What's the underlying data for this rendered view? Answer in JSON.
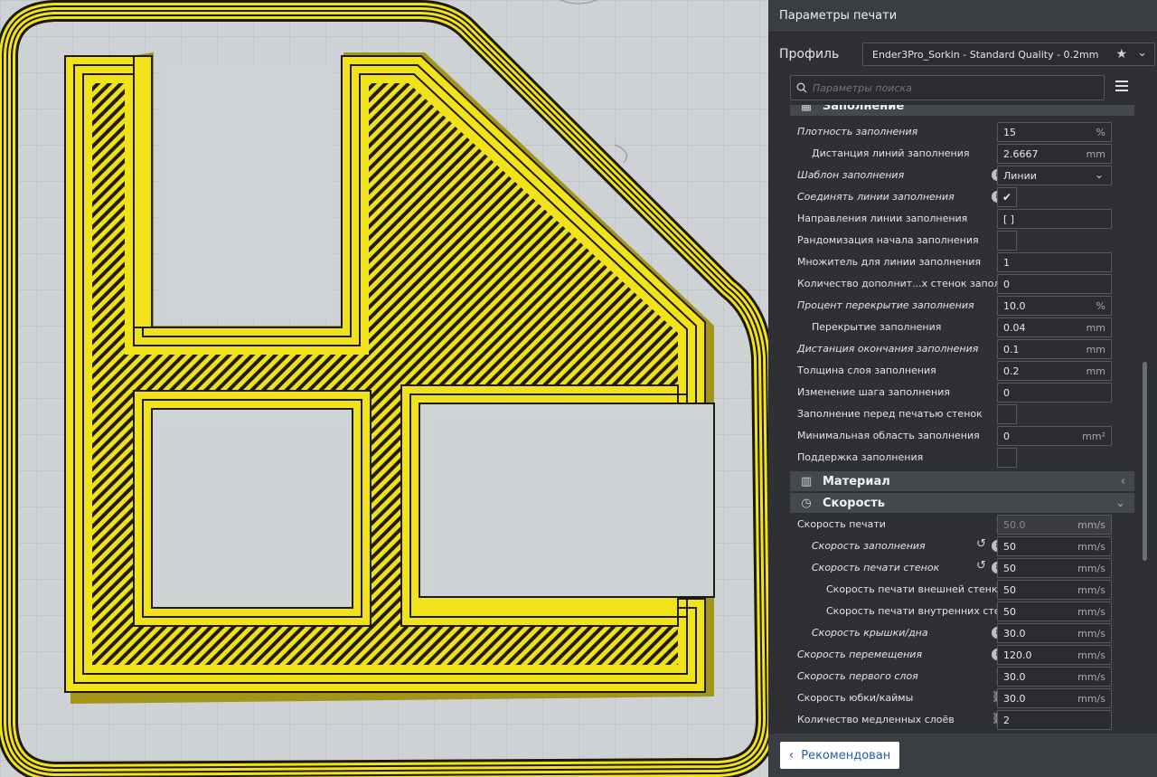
{
  "panel": {
    "title": "Параметры печати",
    "profile_label": "Профиль",
    "profile_value": "Ender3Pro_Sorkin - Standard Quality - 0.2mm",
    "search_placeholder": "Параметры поиска"
  },
  "categories": {
    "infill": "Заполнение",
    "material": "Материал",
    "speed": "Скорость"
  },
  "infill_rows": [
    {
      "label": "Плотность заполнения",
      "value": "15",
      "unit": "%"
    },
    {
      "label": "Дистанция линий заполнения",
      "value": "2.6667",
      "unit": "mm"
    },
    {
      "label": "Шаблон заполнения",
      "value": "Линии",
      "unit": ""
    },
    {
      "label": "Соединять линии заполнения",
      "value": "✔",
      "unit": ""
    },
    {
      "label": "Направления линии заполнения",
      "value": "[ ]",
      "unit": ""
    },
    {
      "label": "Рандомизация начала заполнения",
      "value": "",
      "unit": ""
    },
    {
      "label": "Множитель для линии заполнения",
      "value": "1",
      "unit": ""
    },
    {
      "label": "Количество дополнит...х стенок заполнения",
      "value": "0",
      "unit": ""
    },
    {
      "label": "Процент перекрытие заполнения",
      "value": "10.0",
      "unit": "%"
    },
    {
      "label": "Перекрытие заполнения",
      "value": "0.04",
      "unit": "mm"
    },
    {
      "label": "Дистанция окончания заполнения",
      "value": "0.1",
      "unit": "mm"
    },
    {
      "label": "Толщина слоя заполнения",
      "value": "0.2",
      "unit": "mm"
    },
    {
      "label": "Изменение шага заполнения",
      "value": "0",
      "unit": ""
    },
    {
      "label": "Заполнение перед печатью стенок",
      "value": "",
      "unit": ""
    },
    {
      "label": "Минимальная область заполнения",
      "value": "0",
      "unit": "mm²"
    },
    {
      "label": "Поддержка заполнения",
      "value": "",
      "unit": ""
    }
  ],
  "speed_rows": [
    {
      "label": "Скорость печати",
      "value": "50.0",
      "unit": "mm/s"
    },
    {
      "label": "Скорость заполнения",
      "value": "50",
      "unit": "mm/s"
    },
    {
      "label": "Скорость печати стенок",
      "value": "50",
      "unit": "mm/s"
    },
    {
      "label": "Скорость печати внешней стенки",
      "value": "50",
      "unit": "mm/s"
    },
    {
      "label": "Скорость печати внутренних стенок",
      "value": "50",
      "unit": "mm/s"
    },
    {
      "label": "Скорость крышки/дна",
      "value": "30.0",
      "unit": "mm/s"
    },
    {
      "label": "Скорость перемещения",
      "value": "120.0",
      "unit": "mm/s"
    },
    {
      "label": "Скорость первого слоя",
      "value": "30.0",
      "unit": "mm/s"
    },
    {
      "label": "Скорость юбки/каймы",
      "value": "30.0",
      "unit": "mm/s"
    },
    {
      "label": "Количество медленных слоёв",
      "value": "2",
      "unit": ""
    }
  ],
  "footer": {
    "recommended_label": "Рекомендован"
  },
  "colors": {
    "filament": "#f2e21a",
    "panel_bg": "#2e3033",
    "accent_link": "#1f5fb5"
  }
}
